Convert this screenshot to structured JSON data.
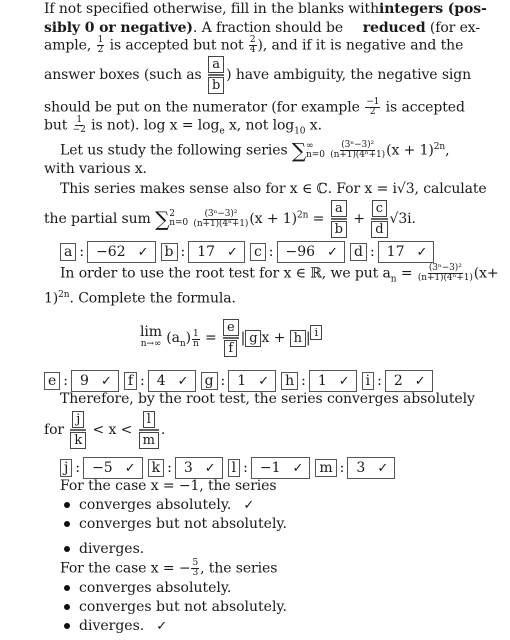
{
  "instructions": {
    "line1_pre": "If not specified otherwise, fill in the blanks with",
    "line1_bold": "integers (pos-",
    "line2_bold": "sibly 0 or negative)",
    "line2_mid": ". A fraction should be",
    "line2_bold2": "reduced",
    "line2_post": "(for ex-",
    "line3_pre": "ample,",
    "line3_frac1_num": "1",
    "line3_frac1_den": "2",
    "line3_mid": "is accepted but not",
    "line3_frac2_num": "2",
    "line3_frac2_den": "4",
    "line3_post": "), and if it is negative and the",
    "line4_pre": "answer boxes (such as",
    "line4_box_num": "a",
    "line4_box_den": "b",
    "line4_post": ") have ambiguity, the negative sign",
    "line5_pre": "should be put on the numerator (for example",
    "line5_frac_num": "−1",
    "line5_frac_den": "2",
    "line5_post": "is accepted",
    "line6_pre": "but",
    "line6_frac_num": "1",
    "line6_frac_den": "−2",
    "line6_post": "is not). log x = log",
    "line6_sub_e": "e",
    "line6_mid": "x, not log",
    "line6_sub_10": "10",
    "line6_end": "x."
  },
  "series_intro": {
    "text1": "Let us study the following series",
    "sigma": "∑",
    "upper": "∞",
    "lower": "n=0",
    "frac_num": "(3ⁿ−3)²",
    "frac_den": "(n+1)(4ⁿ+1)",
    "term": "(x + 1)",
    "exp": "2n",
    "comma": ",",
    "line2": "with various x."
  },
  "complex_part": {
    "line1": "This series makes sense also for x ∈ ℂ. For x = i√3, calculate",
    "line2_pre": "the partial sum",
    "sigma": "∑",
    "upper": "2",
    "lower": "n=0",
    "frac_num": "(3ⁿ−3)²",
    "frac_den": "(n+1)(4ⁿ+1)",
    "term": "(x + 1)",
    "exp": "2n",
    "eq": "=",
    "box_a": "a",
    "box_b": "b",
    "plus": "+",
    "box_c": "c",
    "box_d": "d",
    "tail": "√3i."
  },
  "answers1": [
    {
      "label": "a",
      "value": "−62",
      "check": "✓"
    },
    {
      "label": "b",
      "value": "17",
      "check": "✓"
    },
    {
      "label": "c",
      "value": "−96",
      "check": "✓"
    },
    {
      "label": "d",
      "value": "17",
      "check": "✓"
    }
  ],
  "root_test": {
    "line1_pre": "In order to use the root test for x ∈ ℝ, we put a",
    "line1_sub": "n",
    "line1_eq": "=",
    "frac_num": "(3ⁿ−3)²",
    "frac_den": "(n+1)(4ⁿ+1)",
    "line1_post": "(x+",
    "line2_pre": "1)",
    "line2_exp": "2n",
    "line2_post": ". Complete the formula."
  },
  "formula": {
    "lim": "lim",
    "lim_sub": "n→∞",
    "an": "(a",
    "an_sub": "n",
    "an_close": ")",
    "power_num": "1",
    "power_den": "n",
    "eq": "=",
    "box_e": "e",
    "box_f": "f",
    "abs_open": "|",
    "box_g": "g",
    "x": "x +",
    "box_h": "h",
    "abs_close": "|",
    "box_i": "i"
  },
  "answers2": [
    {
      "label": "e",
      "value": "9",
      "check": "✓"
    },
    {
      "label": "f",
      "value": "4",
      "check": "✓"
    },
    {
      "label": "g",
      "value": "1",
      "check": "✓"
    },
    {
      "label": "h",
      "value": "1",
      "check": "✓"
    },
    {
      "label": "i",
      "value": "2",
      "check": "✓"
    }
  ],
  "conclusion": {
    "line1": "Therefore, by the root test, the series converges absolutely",
    "for": "for",
    "box_j": "j",
    "box_k": "k",
    "ineq": "< x <",
    "box_l": "l",
    "box_m": "m",
    "period": "."
  },
  "answers3": [
    {
      "label": "j",
      "value": "−5",
      "check": "✓"
    },
    {
      "label": "k",
      "value": "3",
      "check": "✓"
    },
    {
      "label": "l",
      "value": "−1",
      "check": "✓"
    },
    {
      "label": "m",
      "value": "3",
      "check": "✓"
    }
  ],
  "case1": {
    "heading": "For the case x = −1, the series",
    "options": [
      {
        "label": "converges absolutely.",
        "check": "✓"
      },
      {
        "label": "converges but not absolutely.",
        "check": ""
      },
      {
        "label": "diverges.",
        "check": ""
      }
    ]
  },
  "case2": {
    "heading_pre": "For the case x = −",
    "frac_num": "5",
    "frac_den": "3",
    "heading_post": ", the series",
    "options": [
      {
        "label": "converges absolutely.",
        "check": ""
      },
      {
        "label": "converges but not absolutely.",
        "check": ""
      },
      {
        "label": "diverges.",
        "check": "✓"
      }
    ]
  }
}
